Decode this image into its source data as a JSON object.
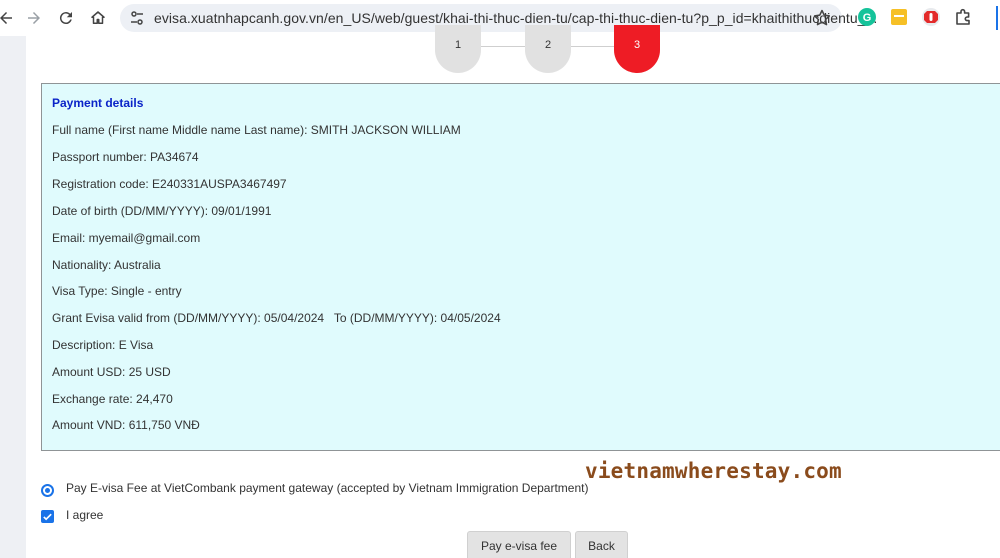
{
  "browser": {
    "url": "evisa.xuatnhapcanh.gov.vn/en_US/web/guest/khai-thi-thuc-dien-tu/cap-thi-thuc-dien-tu?p_p_id=khaithithucdientu_..."
  },
  "steps": [
    "1",
    "2",
    "3"
  ],
  "active_step": "3",
  "payment": {
    "title": "Payment details",
    "rows": [
      "Full name (First name Middle name Last name): SMITH JACKSON WILLIAM",
      "Passport number: PA34674",
      "Registration code: E240331AUSPA3467497",
      "Date of birth (DD/MM/YYYY): 09/01/1991",
      "Email: myemail@gmail.com",
      "Nationality: Australia",
      "Visa Type: Single - entry",
      "Grant Evisa valid from (DD/MM/YYYY): 05/04/2024   To (DD/MM/YYYY): 04/05/2024",
      "Description: E Visa",
      "Amount USD: 25 USD",
      "Exchange rate: 24,470",
      "Amount VND: 611,750 VNĐ"
    ]
  },
  "watermark": "vietnamwherestay.com",
  "options": {
    "gateway_label": "Pay E-visa Fee at VietCombank payment gateway (accepted by Vietnam Immigration Department)",
    "agree_label": "I agree"
  },
  "buttons": {
    "pay": "Pay e-visa fee",
    "back": "Back"
  },
  "colors": {
    "panel_bg": "#e0fbfd",
    "title_blue": "#0a23c8",
    "active_step": "#ee1c25",
    "watermark": "#8a4b1c"
  }
}
